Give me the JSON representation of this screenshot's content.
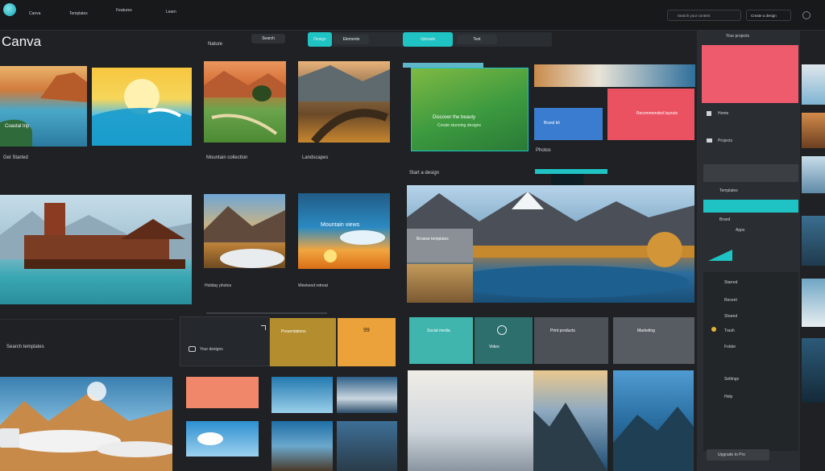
{
  "app": {
    "logo_text": "Canva",
    "brand_color": "#1fc8c8",
    "accent_coral": "#ef5a6a"
  },
  "topbar": {
    "nav_items": [
      "Canva",
      "Templates",
      "Features",
      "Learn"
    ],
    "right_search": "Search your content",
    "right_btn": "Create a design"
  },
  "sections": {
    "row1_caption": "Get Started",
    "col_caption_a": "Mountain collection",
    "col_caption_b": "Landscapes",
    "travel": "Nature",
    "lower_heading": "Start a design"
  },
  "cards": {
    "coast_caption": "Coastal trip",
    "green_title": "Discover the beauty",
    "green_sub": "Create stunning designs",
    "blue_tile": "Brand kit",
    "coral_tile": "Recommended layouts",
    "mountains_tile": "Mountain views",
    "alps_tile": "Browse templates",
    "peak_tile": "Photos",
    "mustard_tile": "Presentations",
    "orange_tile": "99",
    "teal_tile_a": "Social media",
    "teal_tile_b": "Video",
    "gray_tile_a": "Print products",
    "gray_tile_b": "Marketing",
    "left_small": "Search templates",
    "left_small_sub": "Your designs",
    "mid_caption_a": "Holiday photos",
    "mid_caption_b": "Weekend retreat"
  },
  "sidebar": {
    "header": "Your projects",
    "items": [
      "Home",
      "Projects",
      "Templates",
      "Brand",
      "Apps",
      "Starred",
      "Recent",
      "Shared",
      "Trash",
      "Folder",
      "Settings",
      "Help"
    ],
    "active_item": "Templates",
    "footer": "Upgrade to Pro"
  },
  "toolbar": {
    "tab_a": "Design",
    "tab_b": "Elements",
    "tab_c": "Uploads",
    "tab_d": "Text",
    "search_label": "Search"
  }
}
